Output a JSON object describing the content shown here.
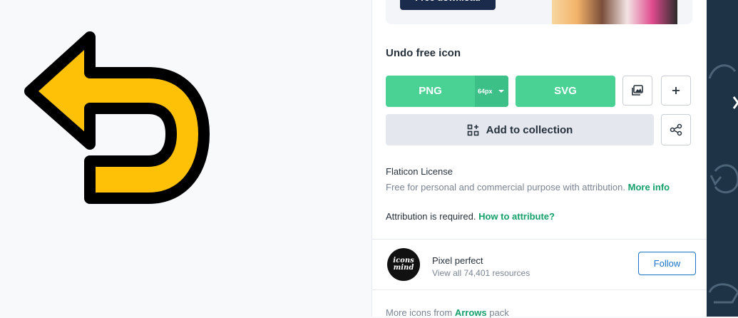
{
  "promo": {
    "button_label": "Free download"
  },
  "icon": {
    "name": "Undo free icon",
    "fill_color": "#ffc107",
    "stroke_color": "#000000"
  },
  "download": {
    "png_label": "PNG",
    "png_size": "64px",
    "svg_label": "SVG",
    "add_to_collection_label": "Add to collection"
  },
  "license": {
    "title": "Flaticon License",
    "text": "Free for personal and commercial purpose with attribution.",
    "more_info": "More info",
    "attribution_text": "Attribution is required.",
    "attribution_link": "How to attribute?"
  },
  "author": {
    "avatar_text_line1": "icons",
    "avatar_text_line2": "mind",
    "name": "Pixel perfect",
    "resources": "View all 74,401 resources",
    "follow_label": "Follow"
  },
  "more_icons": {
    "prefix": "More icons from",
    "pack": "Arrows",
    "suffix": "pack"
  },
  "colors": {
    "accent_green": "#4ad295",
    "link_green": "#14a06a",
    "follow_blue": "#1a73c8",
    "sidebar_bg": "#1e3345"
  }
}
